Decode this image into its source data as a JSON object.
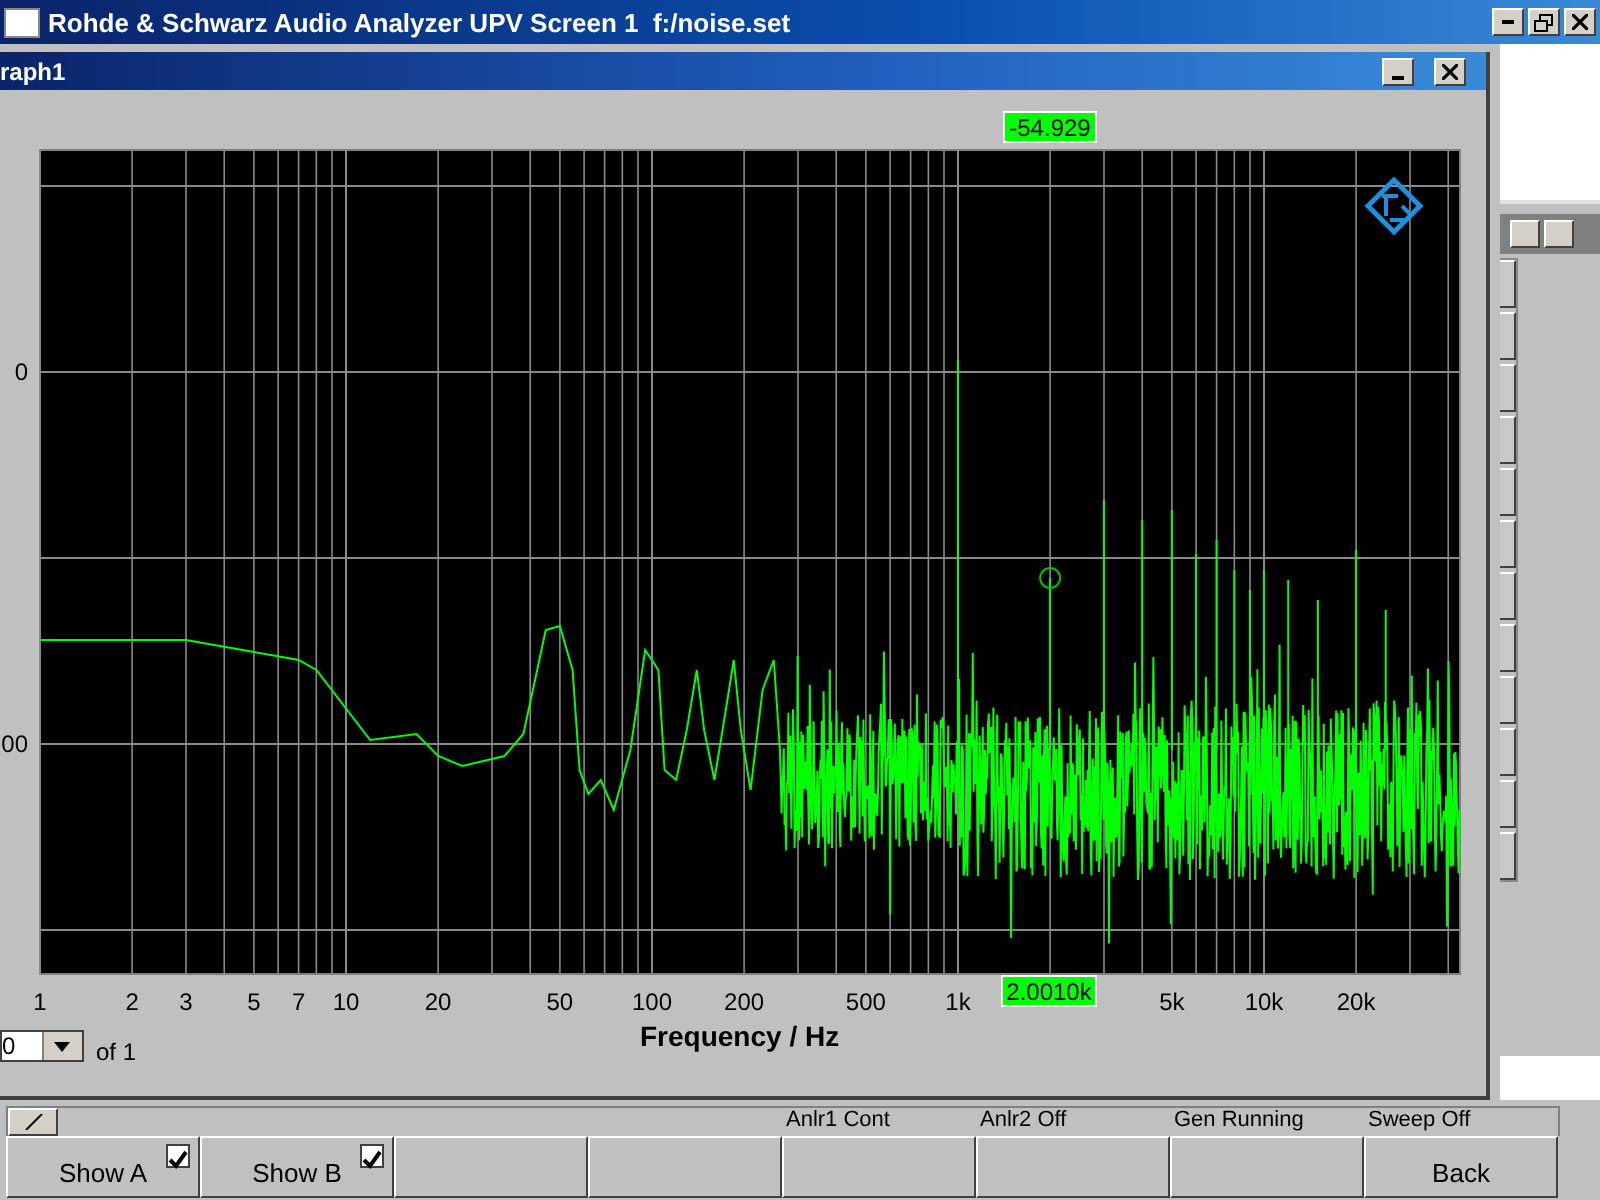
{
  "app": {
    "title": "Rohde & Schwarz Audio Analyzer UPV Screen 1  f:/noise.set"
  },
  "graph_window": {
    "title": "raph1",
    "cursor_readouts": {
      "level": "-54.929",
      "frequency": "2.0010k"
    },
    "y_ticks": [
      "0",
      "00"
    ],
    "x_ticks": [
      "1",
      "2",
      "3",
      "5",
      "7",
      "10",
      "20",
      "50",
      "100",
      "200",
      "500",
      "1k",
      "5k",
      "10k",
      "20k"
    ],
    "xlabel": "Frequency / Hz",
    "page_select": {
      "value": "0",
      "suffix": "of 1"
    }
  },
  "softkey_panel": {
    "status": [
      "Anlr1 Cont",
      "Anlr2 Off",
      "Gen Running",
      "Sweep Off"
    ],
    "softkeys": [
      {
        "kind": "checkbox",
        "label": "Show A",
        "checked": true
      },
      {
        "kind": "checkbox",
        "label": "Show B",
        "checked": true
      },
      {
        "kind": "blank"
      },
      {
        "kind": "blank"
      },
      {
        "kind": "blank"
      },
      {
        "kind": "blank"
      },
      {
        "kind": "blank"
      },
      {
        "kind": "plain",
        "label": "Back"
      }
    ]
  }
}
